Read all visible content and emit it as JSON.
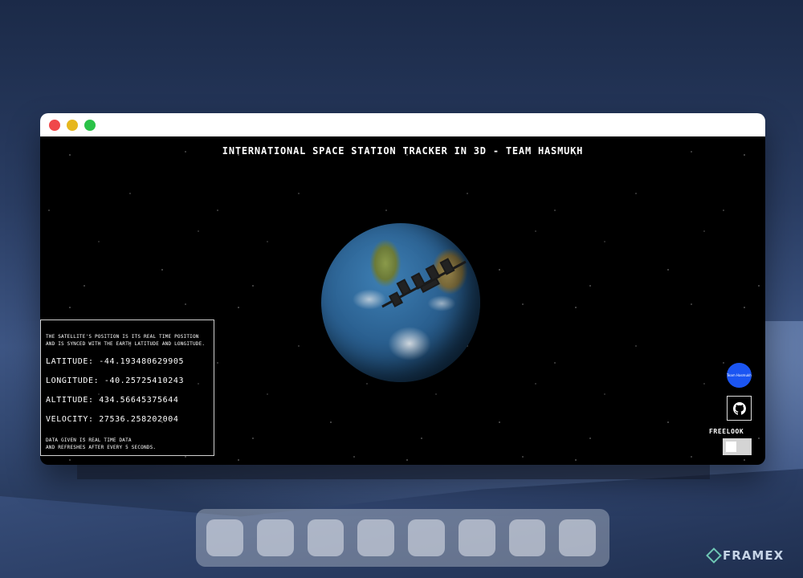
{
  "app": {
    "title": "INTERNATIONAL SPACE STATION TRACKER IN 3D - TEAM HASMUKH"
  },
  "info_panel": {
    "note_line1": "THE SATELLITE'S POSITION IS ITS REAL TIME POSITION",
    "note_line2": "AND IS SYNCED WITH THE EARTH LATITUDE AND LONGITUDE.",
    "latitude": "LATITUDE: -44.193480629905",
    "longitude": "LONGITUDE: -40.25725410243",
    "altitude": "ALTITUDE: 434.56645375644",
    "velocity": "VELOCITY: 27536.258202004",
    "footer_line1": "DATA GIVEN IS REAL TIME DATA",
    "footer_line2": "AND REFRESHES AFTER EVERY 5 SECONDS."
  },
  "controls": {
    "team_badge": "Team Hasmukh",
    "github_icon": "github-icon",
    "freelook_label": "FREELOOK",
    "freelook_enabled": false
  },
  "desktop": {
    "watermark": "FRAMEX",
    "dock_tile_count": 8
  },
  "colors": {
    "badge": "#1b55f2",
    "close": "#f0484a",
    "minimize": "#e6b71e",
    "maximize": "#2ac248"
  }
}
